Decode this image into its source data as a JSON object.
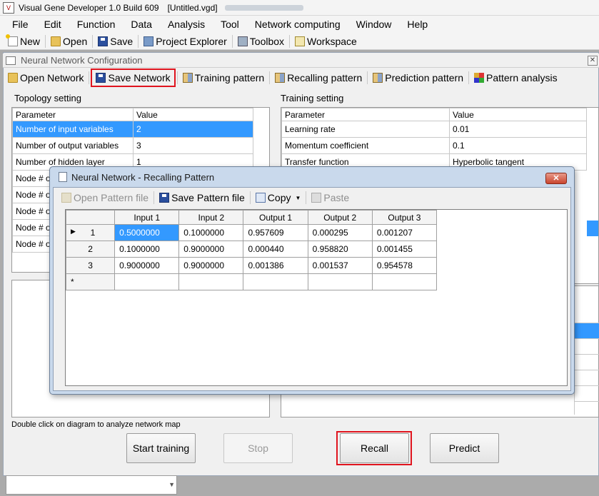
{
  "app": {
    "title": "Visual Gene Developer 1.0 Build 609",
    "document": "[Untitled.vgd]",
    "menu": [
      "File",
      "Edit",
      "Function",
      "Data",
      "Analysis",
      "Tool",
      "Network computing",
      "Window",
      "Help"
    ],
    "toolbar": {
      "new": "New",
      "open": "Open",
      "save": "Save",
      "project_explorer": "Project Explorer",
      "toolbox": "Toolbox",
      "workspace": "Workspace"
    }
  },
  "nn_window": {
    "title": "Neural Network Configuration",
    "toolbar": {
      "open_network": "Open Network",
      "save_network": "Save Network",
      "training_pattern": "Training pattern",
      "recalling_pattern": "Recalling pattern",
      "prediction_pattern": "Prediction pattern",
      "pattern_analysis": "Pattern analysis"
    },
    "topology": {
      "label": "Topology setting",
      "headers": [
        "Parameter",
        "Value"
      ],
      "rows": [
        [
          "Number of input variables",
          "2"
        ],
        [
          "Number of output variables",
          "3"
        ],
        [
          "Number of hidden layer",
          "1"
        ],
        [
          "Node # o",
          ""
        ],
        [
          "Node # o",
          ""
        ],
        [
          "Node # o",
          ""
        ],
        [
          "Node # o",
          ""
        ],
        [
          "Node # o",
          ""
        ]
      ]
    },
    "training": {
      "label": "Training setting",
      "headers": [
        "Parameter",
        "Value"
      ],
      "rows": [
        [
          "Learning rate",
          "0.01"
        ],
        [
          "Momentum coefficient",
          "0.1"
        ],
        [
          "Transfer function",
          "Hyperbolic tangent"
        ]
      ]
    },
    "hint": "Double click on diagram to analyze network map",
    "buttons": {
      "start_training": "Start training",
      "stop": "Stop",
      "recall": "Recall",
      "predict": "Predict"
    }
  },
  "recall_dialog": {
    "title": "Neural Network - Recalling Pattern",
    "close": "✕",
    "toolbar": {
      "open_pattern": "Open Pattern file",
      "save_pattern": "Save Pattern file",
      "copy": "Copy",
      "paste": "Paste"
    },
    "headers": [
      "Input 1",
      "Input 2",
      "Output 1",
      "Output 2",
      "Output 3"
    ],
    "rows": [
      {
        "id": "1",
        "values": [
          "0.5000000",
          "0.1000000",
          "0.957609",
          "0.000295",
          "0.001207"
        ]
      },
      {
        "id": "2",
        "values": [
          "0.1000000",
          "0.9000000",
          "0.000440",
          "0.958820",
          "0.001455"
        ]
      },
      {
        "id": "3",
        "values": [
          "0.9000000",
          "0.9000000",
          "0.001386",
          "0.001537",
          "0.954578"
        ]
      }
    ],
    "new_row_marker": "*",
    "current_row_marker": "▶"
  }
}
